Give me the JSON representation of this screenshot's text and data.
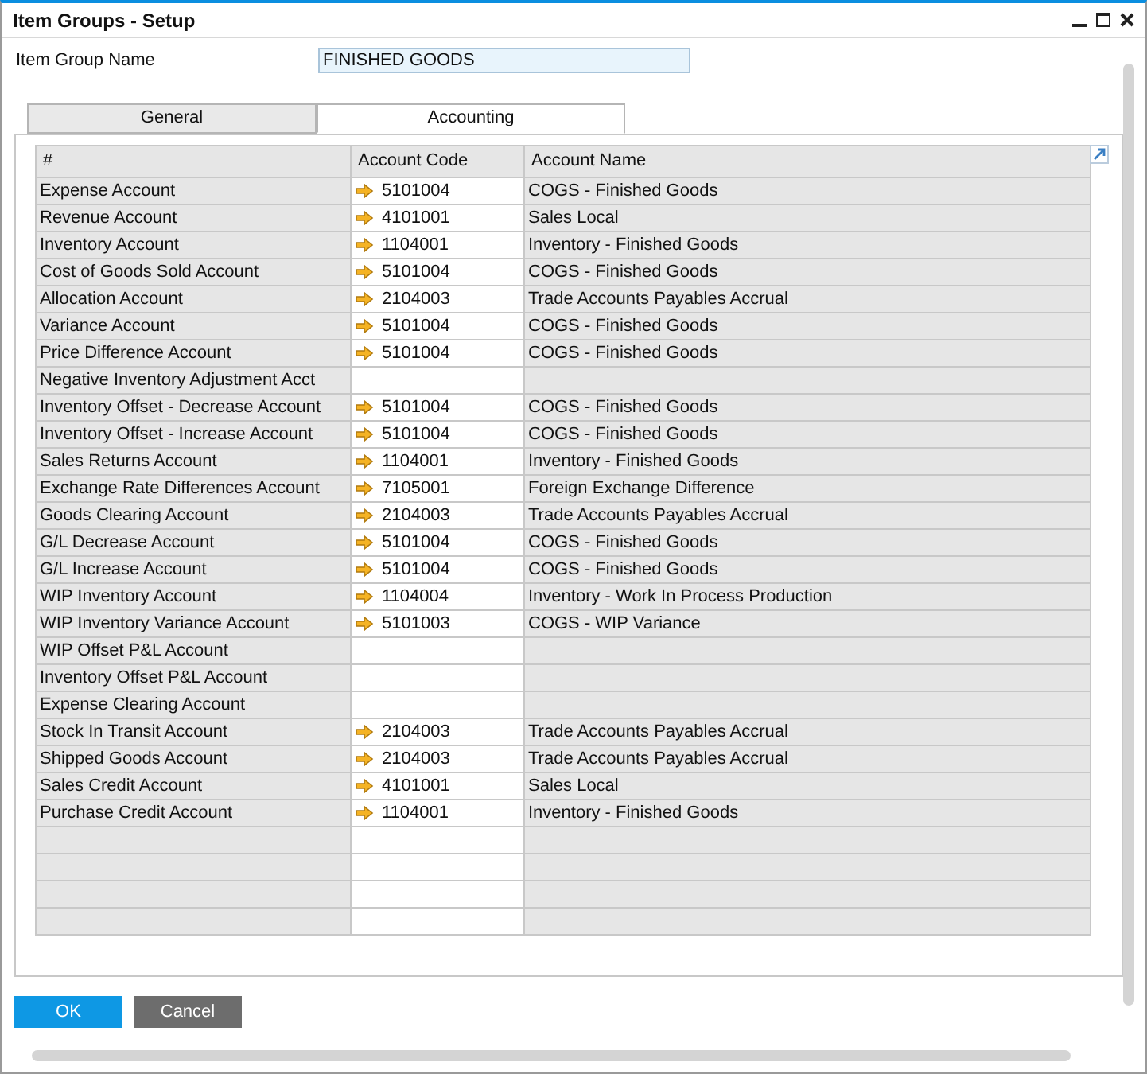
{
  "window": {
    "title": "Item Groups - Setup"
  },
  "item_group_name": {
    "label": "Item Group Name",
    "value": "FINISHED GOODS"
  },
  "tabs": [
    {
      "label": "General",
      "selected": false
    },
    {
      "label": "Accounting",
      "selected": true
    }
  ],
  "table": {
    "columns": [
      "#",
      "Account Code",
      "Account Name"
    ],
    "rows": [
      {
        "name": "Expense Account",
        "code": "5101004",
        "account_name": "COGS - Finished Goods"
      },
      {
        "name": "Revenue Account",
        "code": "4101001",
        "account_name": "Sales Local"
      },
      {
        "name": "Inventory Account",
        "code": "1104001",
        "account_name": "Inventory - Finished Goods"
      },
      {
        "name": "Cost of Goods Sold Account",
        "code": "5101004",
        "account_name": "COGS - Finished Goods"
      },
      {
        "name": "Allocation Account",
        "code": "2104003",
        "account_name": "Trade Accounts Payables Accrual"
      },
      {
        "name": "Variance Account",
        "code": "5101004",
        "account_name": "COGS - Finished Goods"
      },
      {
        "name": "Price Difference Account",
        "code": "5101004",
        "account_name": "COGS - Finished Goods"
      },
      {
        "name": "Negative Inventory Adjustment Acct"
      },
      {
        "name": "Inventory Offset - Decrease Account",
        "code": "5101004",
        "account_name": "COGS - Finished Goods"
      },
      {
        "name": "Inventory Offset - Increase Account",
        "code": "5101004",
        "account_name": "COGS - Finished Goods"
      },
      {
        "name": "Sales Returns Account",
        "code": "1104001",
        "account_name": "Inventory - Finished Goods"
      },
      {
        "name": "Exchange Rate Differences Account",
        "code": "7105001",
        "account_name": "Foreign Exchange Difference"
      },
      {
        "name": "Goods Clearing Account",
        "code": "2104003",
        "account_name": "Trade Accounts Payables Accrual"
      },
      {
        "name": "G/L Decrease Account",
        "code": "5101004",
        "account_name": "COGS - Finished Goods"
      },
      {
        "name": "G/L Increase Account",
        "code": "5101004",
        "account_name": "COGS - Finished Goods"
      },
      {
        "name": "WIP Inventory Account",
        "code": "1104004",
        "account_name": "Inventory - Work In Process Production"
      },
      {
        "name": "WIP Inventory Variance Account",
        "code": "5101003",
        "account_name": "COGS - WIP Variance"
      },
      {
        "name": "WIP Offset P&L Account"
      },
      {
        "name": "Inventory Offset P&L Account"
      },
      {
        "name": "Expense Clearing Account"
      },
      {
        "name": "Stock In Transit Account",
        "code": "2104003",
        "account_name": "Trade Accounts Payables Accrual"
      },
      {
        "name": "Shipped Goods Account",
        "code": "2104003",
        "account_name": "Trade Accounts Payables Accrual"
      },
      {
        "name": "Sales Credit Account",
        "code": "4101001",
        "account_name": "Sales Local"
      },
      {
        "name": "Purchase Credit Account",
        "code": "1104001",
        "account_name": "Inventory - Finished Goods"
      }
    ]
  },
  "buttons": [
    {
      "label": "OK",
      "kind": "primary"
    },
    {
      "label": "Cancel",
      "kind": "secondary"
    }
  ]
}
